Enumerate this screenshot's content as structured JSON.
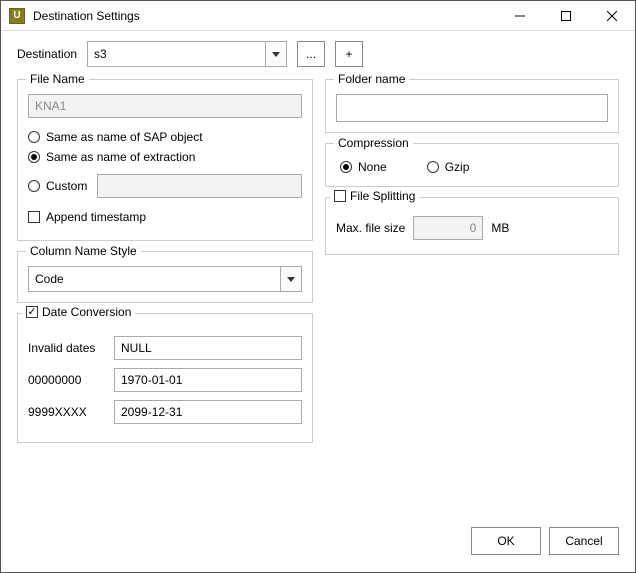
{
  "titlebar": {
    "app_icon_letter": "U",
    "title": "Destination Settings"
  },
  "destination": {
    "label": "Destination",
    "value": "s3",
    "browse_label": "...",
    "add_label": "+"
  },
  "filename": {
    "legend": "File Name",
    "value": "KNA1",
    "opt_sap": "Same as name of SAP object",
    "opt_extraction": "Same as name of extraction",
    "opt_custom": "Custom",
    "custom_value": "",
    "append_ts": "Append timestamp"
  },
  "colstyle": {
    "legend": "Column Name Style",
    "value": "Code"
  },
  "dateconv": {
    "legend": "Date Conversion",
    "invalid_label": "Invalid dates",
    "invalid_value": "NULL",
    "zero_label": "00000000",
    "zero_value": "1970-01-01",
    "nine_label": "9999XXXX",
    "nine_value": "2099-12-31"
  },
  "folder": {
    "legend": "Folder name",
    "value": ""
  },
  "compression": {
    "legend": "Compression",
    "opt_none": "None",
    "opt_gzip": "Gzip"
  },
  "filesplit": {
    "legend": "File Splitting",
    "max_label": "Max. file size",
    "max_value": "0",
    "unit": "MB"
  },
  "footer": {
    "ok": "OK",
    "cancel": "Cancel"
  }
}
